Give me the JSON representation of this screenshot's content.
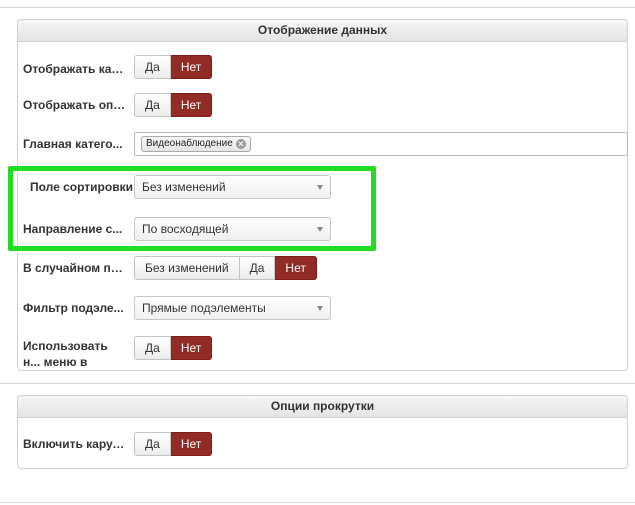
{
  "panels": [
    {
      "title": "Отображение данных",
      "rows": {
        "carousel": {
          "label": "Отображать кар...",
          "yes": "Да",
          "no": "Нет"
        },
        "descr": {
          "label": "Отображать опи...",
          "yes": "Да",
          "no": "Нет"
        },
        "category": {
          "label": "Главная катего...",
          "tag": "Видеонаблюдение",
          "tag_remove": "✕"
        },
        "sort_field": {
          "label": "Поле сортировки",
          "value": "Без изменений"
        },
        "sort_dir": {
          "label": "Направление с...",
          "value": "По восходящей"
        },
        "random": {
          "label": "В случайном по...",
          "opt1": "Без изменений",
          "yes": "Да",
          "no": "Нет"
        },
        "filter": {
          "label": "Фильтр подэле...",
          "value": "Прямые подэлементы"
        },
        "use_menu": {
          "label": "Использовать н... меню в качеств...",
          "yes": "Да",
          "no": "Нет"
        }
      }
    },
    {
      "title": "Опции прокрутки",
      "rows": {
        "enable_carousel": {
          "label": "Включить карус...",
          "yes": "Да",
          "no": "Нет"
        }
      }
    }
  ],
  "colors": {
    "active_button": "#922a25",
    "highlight": "#22dd22"
  }
}
